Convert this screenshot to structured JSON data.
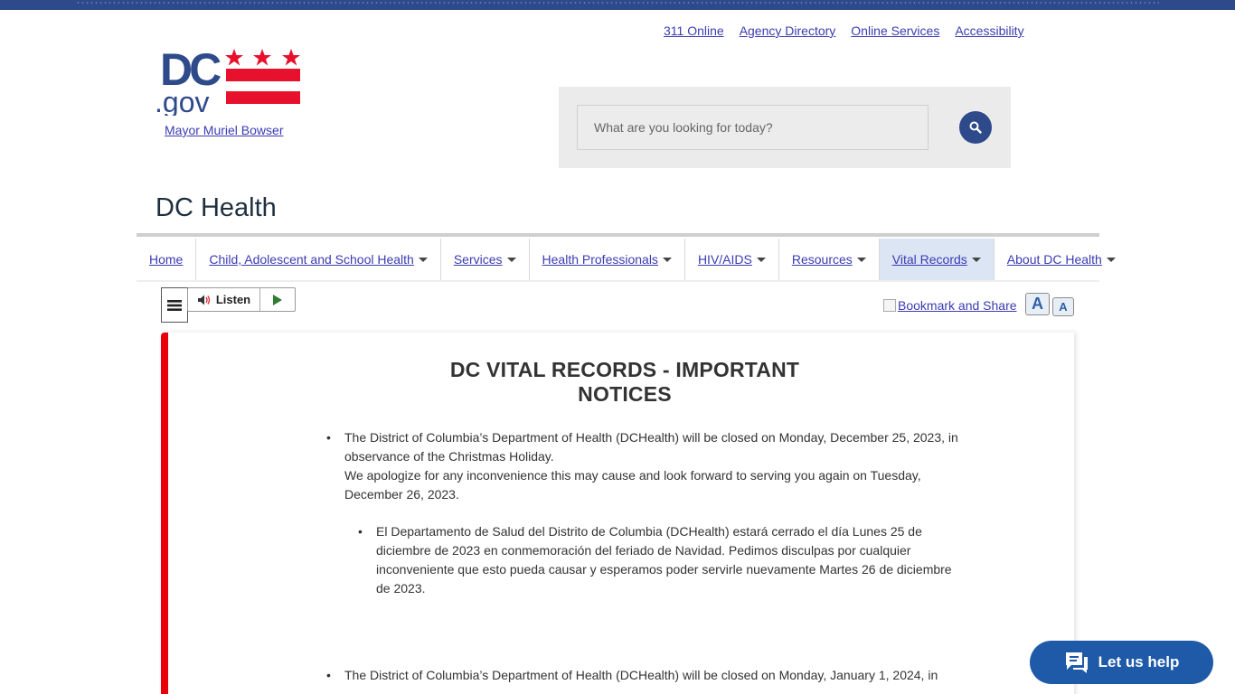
{
  "utility_links": [
    "311 Online",
    "Agency Directory",
    "Online Services",
    "Accessibility"
  ],
  "logo": {
    "dc": "DC",
    "gov": ".gov",
    "mayor_link": "Mayor Muriel Bowser"
  },
  "search": {
    "placeholder": "What are you looking for today?"
  },
  "site_title": "DC Health",
  "nav": [
    {
      "label": "Home",
      "dropdown": false,
      "active": false
    },
    {
      "label": "Child, Adolescent and School Health",
      "dropdown": true,
      "active": false
    },
    {
      "label": "Services",
      "dropdown": true,
      "active": false
    },
    {
      "label": "Health Professionals",
      "dropdown": true,
      "active": false
    },
    {
      "label": "HIV/AIDS",
      "dropdown": true,
      "active": false
    },
    {
      "label": "Resources",
      "dropdown": true,
      "active": false
    },
    {
      "label": "Vital Records",
      "dropdown": true,
      "active": true
    },
    {
      "label": "About DC Health",
      "dropdown": true,
      "active": false
    }
  ],
  "toolbar": {
    "listen_label": "Listen",
    "bookmark_label": "Bookmark and Share",
    "font_increase": "A",
    "font_decrease": "A"
  },
  "content": {
    "title": "DC VITAL RECORDS - IMPORTANT NOTICES",
    "notice1_line1": "The District of Columbia’s Department of Health (DCHealth) will be closed on Monday, December 25, 2023, in observance of the Christmas Holiday.",
    "notice1_line2": "We apologize for any inconvenience this may cause and look forward to serving you again on Tuesday, December 26, 2023.",
    "notice1_es": "El Departamento de Salud del Distrito de Columbia (DCHealth) estará cerrado el día Lunes 25 de diciembre de 2023 en conmemoración del feriado de Navidad.  Pedimos disculpas por cualquier inconveniente que esto pueda causar y esperamos poder servirle nuevamente Martes 26 de diciembre de 2023.",
    "notice2_line1": "The District of Columbia’s Department of Health (DCHealth) will be closed on Monday, January 1, 2024, in"
  },
  "chat": {
    "label": "Let us help"
  },
  "colors": {
    "brand_blue": "#2e4a8a",
    "flag_red": "#e8112d",
    "accent_red": "#e8000b",
    "link": "#3b3bb3",
    "chat_blue": "#1e5aa8"
  }
}
